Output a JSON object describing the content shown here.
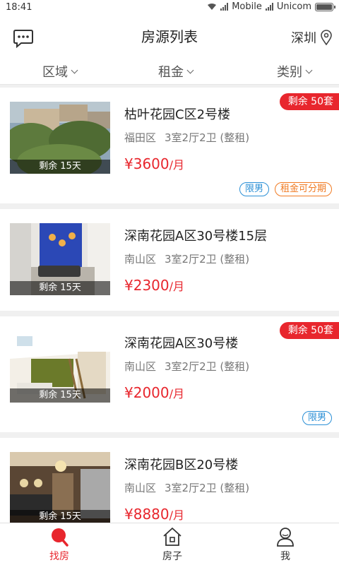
{
  "status_bar": {
    "time": "18:41",
    "carrier1": "Mobile",
    "carrier2": "Unicom"
  },
  "header": {
    "title": "房源列表",
    "city": "深圳",
    "icons": {
      "left": "message-icon",
      "right": "location-pin-icon"
    }
  },
  "filters": [
    {
      "label": "区域"
    },
    {
      "label": "租金"
    },
    {
      "label": "类别"
    }
  ],
  "listings": [
    {
      "title": "枯叶花园C区2号楼",
      "district": "福田区",
      "layout": "3室2厅2卫 (整租)",
      "price_symbol": "¥",
      "price": "3600",
      "price_unit": "/月",
      "remaining_days": "剩余 15天",
      "badge": "剩余 50套",
      "tags": [
        "限男",
        "租金可分期"
      ]
    },
    {
      "title": "深南花园A区30号楼15层",
      "district": "南山区",
      "layout": "3室2厅2卫 (整租)",
      "price_symbol": "¥",
      "price": "2300",
      "price_unit": "/月",
      "remaining_days": "剩余 15天",
      "badge": "",
      "tags": []
    },
    {
      "title": "深南花园A区30号楼",
      "district": "南山区",
      "layout": "3室2厅2卫 (整租)",
      "price_symbol": "¥",
      "price": "2000",
      "price_unit": "/月",
      "remaining_days": "剩余 15天",
      "badge": "剩余 50套",
      "tags": [
        "限男"
      ]
    },
    {
      "title": "深南花园B区20号楼",
      "district": "南山区",
      "layout": "3室2厅2卫 (整租)",
      "price_symbol": "¥",
      "price": "8880",
      "price_unit": "/月",
      "remaining_days": "剩余 15天",
      "badge": "",
      "tags": []
    }
  ],
  "bottom_nav": [
    {
      "label": "找房",
      "icon": "search-house-icon",
      "active": true
    },
    {
      "label": "房子",
      "icon": "house-icon",
      "active": false
    },
    {
      "label": "我",
      "icon": "person-icon",
      "active": false
    }
  ],
  "colors": {
    "accent": "#e8262d",
    "tag_blue": "#2a8fd6",
    "tag_orange": "#f07a22"
  }
}
